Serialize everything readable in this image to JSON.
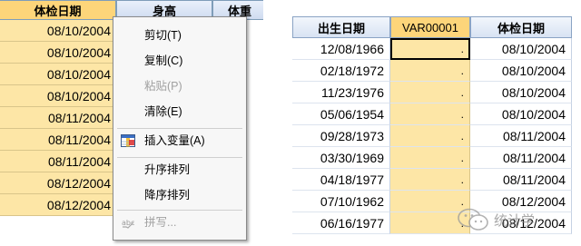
{
  "left_table": {
    "headers": [
      "体检日期",
      "身高",
      "体重"
    ],
    "rows": [
      "08/10/2004",
      "08/10/2004",
      "08/10/2004",
      "08/10/2004",
      "08/11/2004",
      "08/11/2004",
      "08/11/2004",
      "08/12/2004",
      "08/12/2004"
    ]
  },
  "context_menu": {
    "items": [
      {
        "label": "剪切(T)",
        "enabled": true
      },
      {
        "label": "复制(C)",
        "enabled": true
      },
      {
        "label": "粘贴(P)",
        "enabled": false
      },
      {
        "label": "清除(E)",
        "enabled": true
      },
      {
        "label": "插入变量(A)",
        "enabled": true,
        "icon": "insert-variable-icon"
      },
      {
        "label": "升序排列",
        "enabled": true
      },
      {
        "label": "降序排列",
        "enabled": true
      },
      {
        "label": "拼写...",
        "enabled": false,
        "icon": "spellcheck-icon"
      }
    ]
  },
  "right_table": {
    "headers": [
      "出生日期",
      "VAR00001",
      "体检日期"
    ],
    "rows": [
      {
        "birth": "12/08/1966",
        "var": ".",
        "exam": "08/10/2004"
      },
      {
        "birth": "02/18/1972",
        "var": ".",
        "exam": "08/10/2004"
      },
      {
        "birth": "11/23/1976",
        "var": ".",
        "exam": "08/10/2004"
      },
      {
        "birth": "05/06/1954",
        "var": ".",
        "exam": "08/10/2004"
      },
      {
        "birth": "09/28/1973",
        "var": ".",
        "exam": "08/11/2004"
      },
      {
        "birth": "03/30/1969",
        "var": ".",
        "exam": "08/11/2004"
      },
      {
        "birth": "04/18/1977",
        "var": ".",
        "exam": "08/11/2004"
      },
      {
        "birth": "07/10/1962",
        "var": ".",
        "exam": "08/12/2004"
      },
      {
        "birth": "06/16/1977",
        "var": ".",
        "exam": "08/12/2004"
      }
    ]
  },
  "watermark": {
    "text": "统计学"
  },
  "colors": {
    "highlight": "#fde6a6",
    "header": "#d8e3f3",
    "menu_bg": "#f7f7f7"
  }
}
